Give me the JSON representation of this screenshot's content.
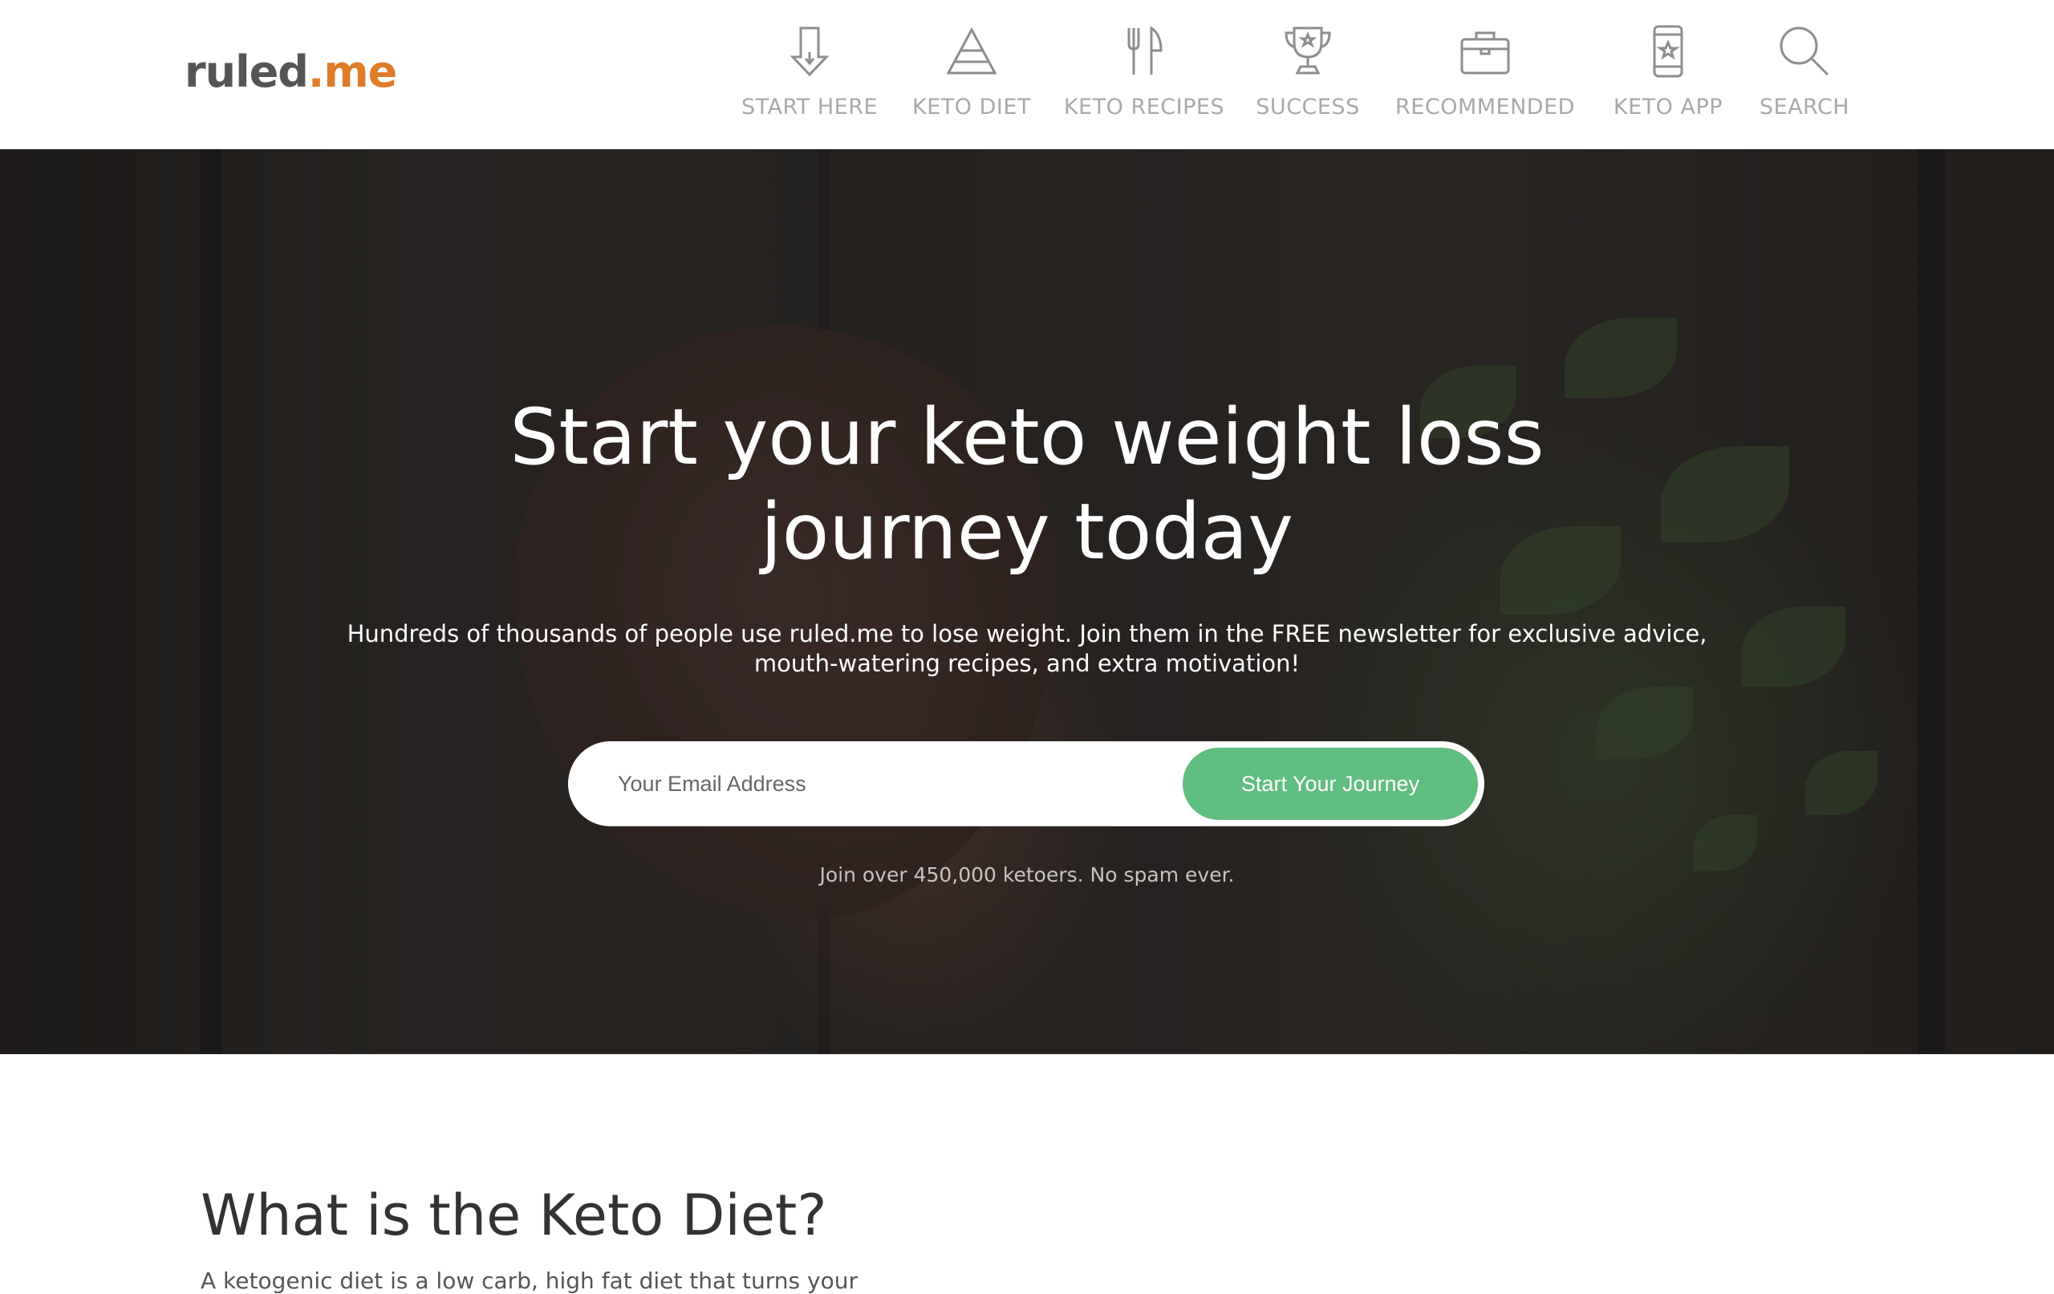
{
  "header": {
    "logo": {
      "main": "ruled",
      "accent": ".me"
    },
    "nav": [
      {
        "label": "START HERE",
        "icon": "download-arrow-icon"
      },
      {
        "label": "KETO DIET",
        "icon": "pyramid-icon"
      },
      {
        "label": "KETO RECIPES",
        "icon": "fork-knife-icon"
      },
      {
        "label": "SUCCESS",
        "icon": "trophy-icon"
      },
      {
        "label": "RECOMMENDED",
        "icon": "briefcase-icon"
      },
      {
        "label": "KETO APP",
        "icon": "phone-icon"
      },
      {
        "label": "SEARCH",
        "icon": "search-icon"
      }
    ]
  },
  "hero": {
    "title_line1": "Start your keto weight loss",
    "title_line2": "journey today",
    "subtitle_line1": "Hundreds of thousands of people use ruled.me to lose weight. Join them in the FREE newsletter for exclusive advice,",
    "subtitle_line2": "mouth-watering recipes, and extra motivation!",
    "email_placeholder": "Your Email Address",
    "email_value": "",
    "cta_label": "Start Your Journey",
    "note": "Join over 450,000 ketoers. No spam ever."
  },
  "content": {
    "title": "What is the Keto Diet?",
    "text": "A ketogenic diet is a low carb, high fat diet that turns your"
  },
  "colors": {
    "accent": "#e07b2a",
    "cta": "#60bd80",
    "nav_text": "#a8a8a8"
  }
}
